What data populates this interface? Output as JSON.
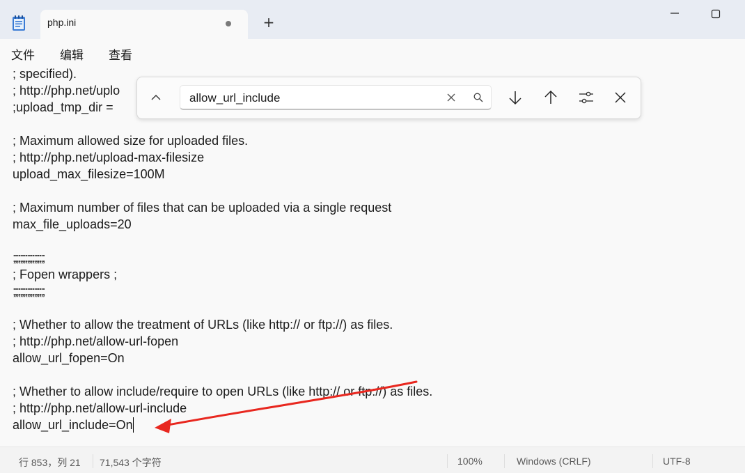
{
  "window": {
    "tab_title": "php.ini",
    "new_tab_label": "+"
  },
  "menu": {
    "file": "文件",
    "edit": "编辑",
    "view": "查看"
  },
  "editor": {
    "lines": [
      "; specified).",
      "; http://php.net/uplo",
      ";upload_tmp_dir =",
      "",
      "; Maximum allowed size for uploaded files.",
      "; http://php.net/upload-max-filesize",
      "upload_max_filesize=100M",
      "",
      "; Maximum number of files that can be uploaded via a single request",
      "max_file_uploads=20",
      "",
      ";;;;;;;;;;;;;;;;;;",
      "; Fopen wrappers ;",
      ";;;;;;;;;;;;;;;;;;",
      "",
      "; Whether to allow the treatment of URLs (like http:// or ftp://) as files.",
      "; http://php.net/allow-url-fopen",
      "allow_url_fopen=On",
      "",
      "; Whether to allow include/require to open URLs (like http:// or ftp://) as files.",
      "; http://php.net/allow-url-include",
      "allow_url_include=On"
    ]
  },
  "find": {
    "query": "allow_url_include"
  },
  "status": {
    "position": "行 853，列 21",
    "char_count": "71,543 个字符",
    "zoom": "100%",
    "line_ending": "Windows (CRLF)",
    "encoding": "UTF-8"
  },
  "annotation": {
    "arrow_color": "#e8271f"
  },
  "icons": {
    "app": "notepad-icon",
    "unsaved": "unsaved-dot-icon",
    "minimize": "minimize-icon",
    "maximize": "maximize-icon",
    "toggle_replace": "chevron-up-icon",
    "clear": "close-icon",
    "search": "search-icon",
    "next": "arrow-down-icon",
    "previous": "arrow-up-icon",
    "options": "sliders-icon",
    "close": "close-icon"
  }
}
